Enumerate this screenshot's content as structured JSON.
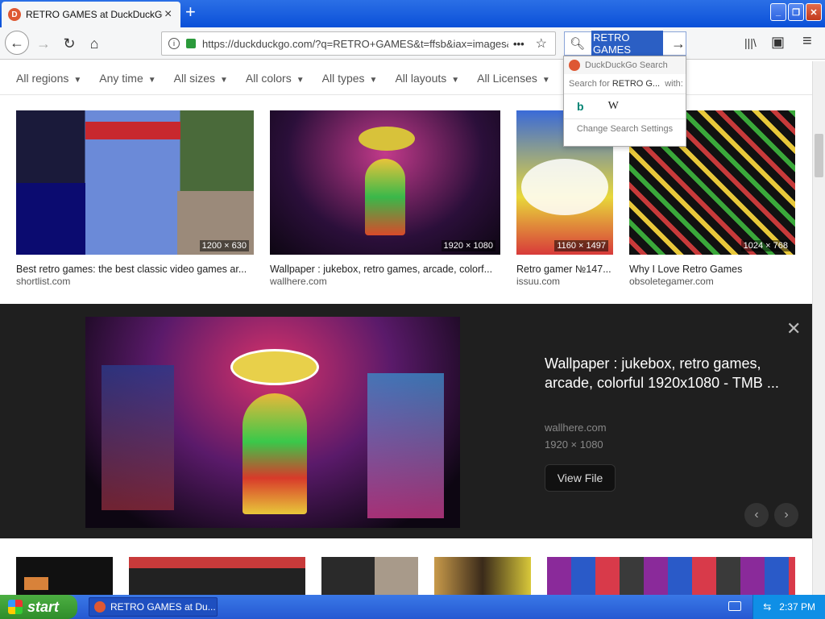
{
  "window": {
    "tab_title": "RETRO GAMES at DuckDuckGo",
    "tab_close": "×",
    "new_tab": "+",
    "min": "_",
    "max": "❐",
    "close": "✕"
  },
  "nav": {
    "back_icon": "←",
    "forward_icon": "→",
    "reload_icon": "↻",
    "home_icon": "⌂",
    "url": "https://duckduckgo.com/?q=RETRO+GAMES&t=ffsb&iax=images&ia=images",
    "page_actions": "•••",
    "bookmark_star": "☆",
    "search_query": "RETRO GAMES",
    "search_go": "→",
    "library_icon": "|||\\",
    "sidebar_icon": "▣",
    "menu_icon": "≡"
  },
  "filters": [
    {
      "label": "All regions"
    },
    {
      "label": "Any time"
    },
    {
      "label": "All sizes"
    },
    {
      "label": "All colors"
    },
    {
      "label": "All types"
    },
    {
      "label": "All layouts"
    },
    {
      "label": "All Licenses"
    }
  ],
  "results": [
    {
      "caption": "Best retro games: the best classic video games ar...",
      "source": "shortlist.com",
      "dims": "1200 × 630"
    },
    {
      "caption": "Wallpaper : jukebox, retro games, arcade, colorf...",
      "source": "wallhere.com",
      "dims": "1920 × 1080"
    },
    {
      "caption": "Retro gamer №147...",
      "source": "issuu.com",
      "dims": "1160 × 1497"
    },
    {
      "caption": "Why I Love Retro Games",
      "source": "obsoletegamer.com",
      "dims": "1024 × 768"
    }
  ],
  "detail": {
    "title": "Wallpaper : jukebox, retro games, arcade, colorful 1920x1080 - TMB ...",
    "source": "wallhere.com",
    "dims": "1920 × 1080",
    "view_file": "View File",
    "close": "✕",
    "prev": "‹",
    "next": "›"
  },
  "search_dropdown": {
    "header": "DuckDuckGo Search",
    "search_for": "Search for",
    "query_short": "RETRO G...",
    "with": "with:",
    "bing": "b",
    "wiki": "W",
    "change_settings": "Change Search Settings"
  },
  "taskbar": {
    "start": "start",
    "task": "RETRO GAMES at Du...",
    "time": "2:37 PM"
  },
  "colors": {
    "titlebar": "#0a50d8",
    "ddg_orange": "#de5833",
    "detail_bg": "#1f1f1f",
    "start_green": "#3c9a34"
  }
}
